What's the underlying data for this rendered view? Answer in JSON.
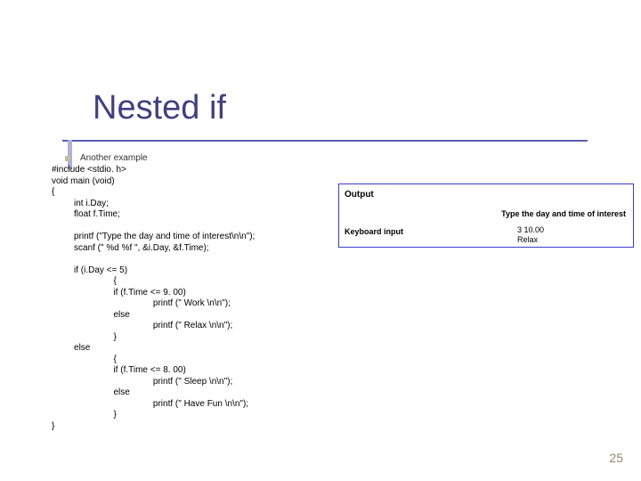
{
  "title": "Nested if",
  "intro": "Another example",
  "code": "#include <stdio. h>\nvoid main (void)\n{\n         int i.Day;\n         float f.Time;\n\n         printf (\"Type the day and time of interest\\n\\n\");\n         scanf (\" %d %f \", &i.Day, &f.Time);\n\n         if (i.Day <= 5)\n                         {\n                         if (f.Time <= 9. 00)\n                                         printf (\" Work \\n\\n\");\n                         else\n                                         printf (\" Relax \\n\\n\");\n                         }\n         else\n                         {\n                         if (f.Time <= 8. 00)\n                                         printf (\" Sleep \\n\\n\");\n                         else\n                                         printf (\" Have Fun \\n\\n\");\n                         }\n}",
  "output": {
    "label": "Output",
    "prompt": "Type the day and time of interest",
    "kbd_label": "Keyboard input",
    "kbd_value": "3 10.00\nRelax"
  },
  "page_number": "25"
}
